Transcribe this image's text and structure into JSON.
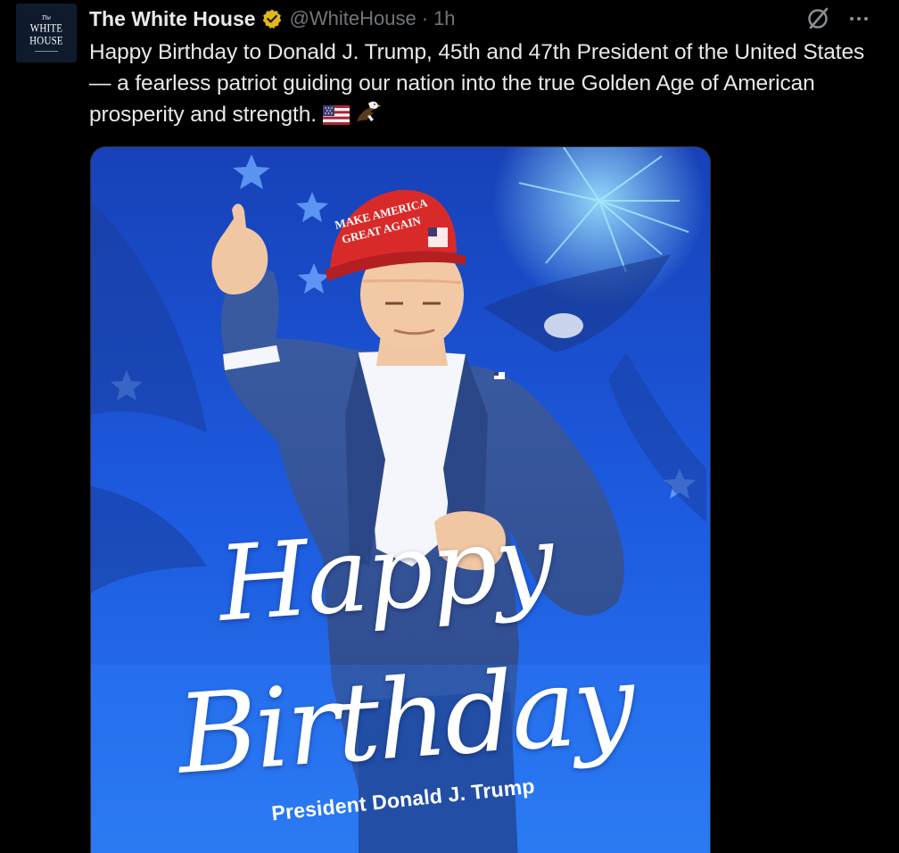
{
  "avatar": {
    "line_small": "The",
    "line1": "WHITE",
    "line2": "HOUSE"
  },
  "header": {
    "display_name": "The White House",
    "handle": "@WhiteHouse",
    "separator": "·",
    "time": "1h"
  },
  "icons": {
    "verified": "verified-badge-icon",
    "grok": "grok-icon",
    "more": "more-options-icon",
    "emoji_flag": "us-flag-emoji",
    "emoji_eagle": "eagle-emoji"
  },
  "tweet": {
    "text": "Happy Birthday to Donald J. Trump, 45th and 47th President of the United States — a fearless patriot guiding our nation into the true Golden Age of American prosperity and strength."
  },
  "media": {
    "hat_line1": "MAKE AMERICA",
    "hat_line2": "GREAT AGAIN",
    "headline_1": "Happy",
    "headline_2": "Birthday",
    "subline": "President Donald J. Trump"
  },
  "colors": {
    "background": "#000000",
    "text_primary": "#e7e9ea",
    "text_secondary": "#71767b",
    "verified_gold": "#e2b719",
    "media_blue": "#1b4fd6",
    "hat_red": "#d92a2a"
  }
}
